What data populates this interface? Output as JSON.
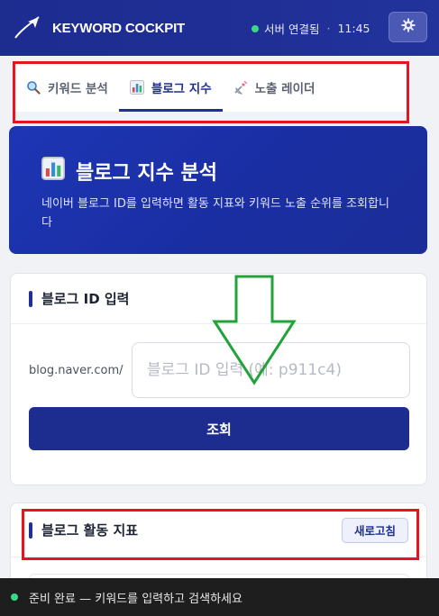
{
  "app": {
    "title": "KEYWORD COCKPIT",
    "logo_icon": "paper-plane-icon"
  },
  "server_status": {
    "label": "서버 연결됨",
    "separator": "·",
    "time": "11:45",
    "color": "#39d98a"
  },
  "settings": {
    "icon": "gear-icon"
  },
  "tabs": [
    {
      "label": "키워드 분석",
      "icon": "magnifier-icon",
      "active": false
    },
    {
      "label": "블로그 지수",
      "icon": "bar-chart-icon",
      "active": true
    },
    {
      "label": "노출 레이더",
      "icon": "satellite-icon",
      "active": false
    }
  ],
  "hero": {
    "title": "블로그 지수 분석",
    "icon": "bar-chart-icon",
    "description": "네이버 블로그 ID를 입력하면 활동 지표와 키워드 노출 순위를 조회합니다"
  },
  "id_card": {
    "title": "블로그 ID 입력",
    "prefix": "blog.naver.com/",
    "input_value": "",
    "placeholder": "블로그 ID 입력 (예: p911c4)",
    "search_label": "조회"
  },
  "activity_card": {
    "title": "블로그 활동 지표",
    "refresh_label": "새로고침"
  },
  "statusbar": {
    "text": "준비 완료 — 키워드를 입력하고 검색하세요"
  },
  "colors": {
    "brand": "#1f2f96",
    "highlight": "#e5141e",
    "annotation_arrow": "#22a33a"
  }
}
